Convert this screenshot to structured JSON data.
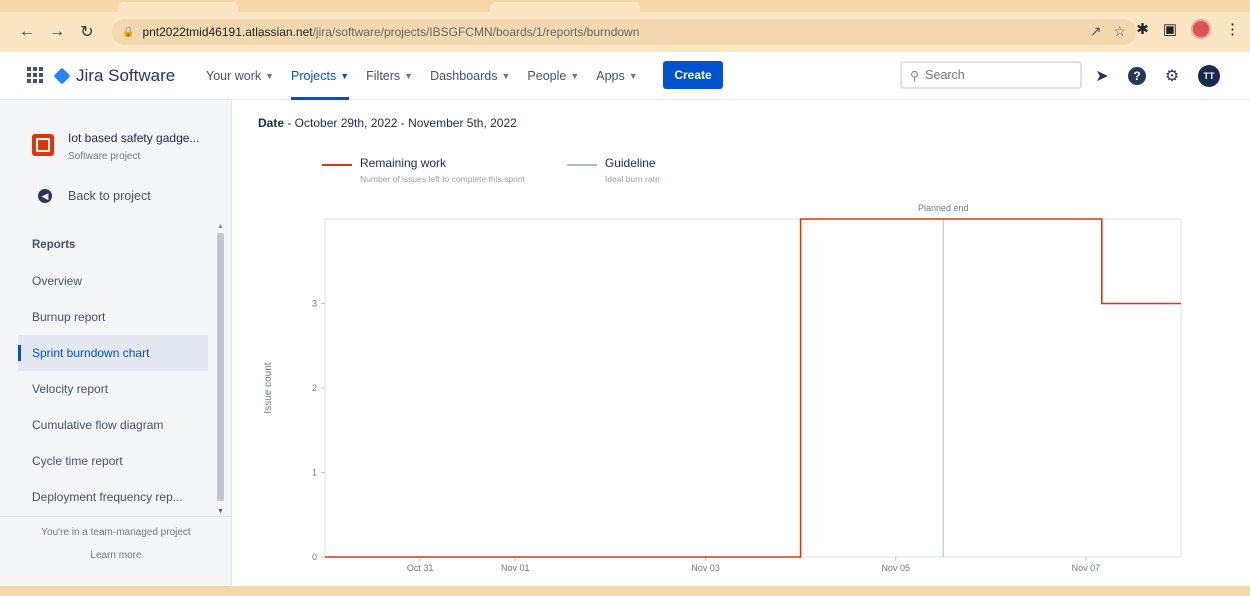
{
  "browser": {
    "url_host": "pnt2022tmid46191.atlassian.net",
    "url_path": "/jira/software/projects/IBSGFCMN/boards/1/reports/burndown"
  },
  "nav": {
    "logo_text": "Jira Software",
    "items": [
      {
        "label": "Your work",
        "active": false
      },
      {
        "label": "Projects",
        "active": true
      },
      {
        "label": "Filters",
        "active": false
      },
      {
        "label": "Dashboards",
        "active": false
      },
      {
        "label": "People",
        "active": false
      },
      {
        "label": "Apps",
        "active": false
      }
    ],
    "create_label": "Create",
    "search_placeholder": "Search",
    "user_initials": "TT"
  },
  "sidebar": {
    "project_name": "Iot based safety gadge...",
    "project_type": "Software project",
    "back_label": "Back to project",
    "reports_heading": "Reports",
    "items": [
      {
        "label": "Overview",
        "selected": false
      },
      {
        "label": "Burnup report",
        "selected": false
      },
      {
        "label": "Sprint burndown chart",
        "selected": true
      },
      {
        "label": "Velocity report",
        "selected": false
      },
      {
        "label": "Cumulative flow diagram",
        "selected": false
      },
      {
        "label": "Cycle time report",
        "selected": false
      },
      {
        "label": "Deployment frequency rep...",
        "selected": false
      }
    ],
    "footer_text": "You're in a team-managed project",
    "footer_link": "Learn more"
  },
  "main": {
    "date_label": "Date",
    "date_value": " - October 29th, 2022 - November 5th, 2022"
  },
  "colors": {
    "remaining": "#de350b",
    "guideline": "#b3bac5",
    "accent": "#0052cc"
  },
  "chart_data": {
    "type": "line",
    "ylabel": "Issue count",
    "ylim": [
      0,
      4
    ],
    "y_ticks": [
      0,
      1,
      2,
      3
    ],
    "x_range": [
      "2022-10-30",
      "2022-11-07T23:59"
    ],
    "x_ticks": [
      {
        "label": "Oct 31",
        "date": "2022-10-31"
      },
      {
        "label": "Nov 01",
        "date": "2022-11-01"
      },
      {
        "label": "Nov 03",
        "date": "2022-11-03"
      },
      {
        "label": "Nov 05",
        "date": "2022-11-05"
      },
      {
        "label": "Nov 07",
        "date": "2022-11-07"
      }
    ],
    "planned_end": {
      "label": "Planned end",
      "date": "2022-11-05T12:00"
    },
    "series": [
      {
        "name": "Remaining work",
        "description": "Number of issues left to complete this sprint",
        "step": true,
        "points": [
          {
            "x": "2022-10-30",
            "y": 0
          },
          {
            "x": "2022-11-04",
            "y": 0
          },
          {
            "x": "2022-11-04",
            "y": 4
          },
          {
            "x": "2022-11-07T04:00",
            "y": 4
          },
          {
            "x": "2022-11-07T04:00",
            "y": 3
          },
          {
            "x": "2022-11-07T23:59",
            "y": 3
          }
        ]
      },
      {
        "name": "Guideline",
        "description": "Ideal burn rate",
        "points": []
      }
    ]
  }
}
